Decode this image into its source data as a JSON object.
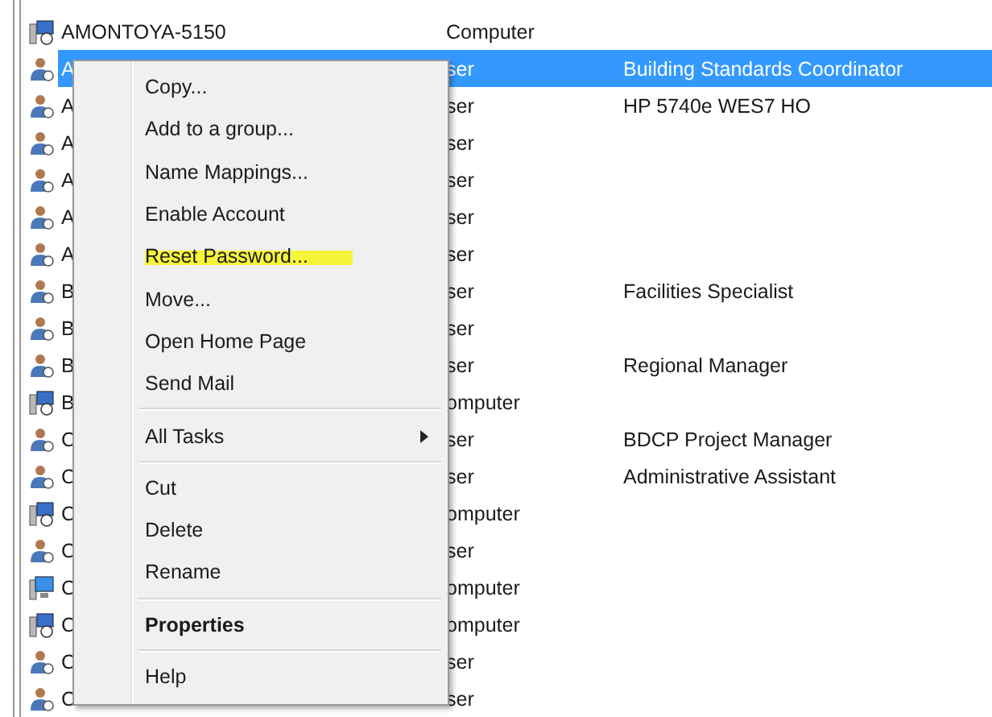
{
  "list": {
    "rows": [
      {
        "kind": "computer",
        "name": "AMONTOYA-5150",
        "type": "Computer",
        "selected": false
      },
      {
        "kind": "user",
        "name": "A",
        "type": "ser",
        "description": "Building Standards Coordinator",
        "selected": true
      },
      {
        "kind": "user",
        "name": "A",
        "type": "ser",
        "description": "HP 5740e WES7 HO",
        "selected": false
      },
      {
        "kind": "user",
        "name": "A",
        "type": "ser",
        "selected": false
      },
      {
        "kind": "user",
        "name": "A",
        "type": "ser",
        "selected": false
      },
      {
        "kind": "user",
        "name": "A",
        "type": "ser",
        "selected": false
      },
      {
        "kind": "user",
        "name": "A",
        "type": "ser",
        "selected": false
      },
      {
        "kind": "user",
        "name": "B",
        "type": "ser",
        "description": "Facilities Specialist",
        "selected": false
      },
      {
        "kind": "user",
        "name": "B",
        "type": "ser",
        "selected": false
      },
      {
        "kind": "user",
        "name": "B",
        "type": "ser",
        "description": "Regional Manager",
        "selected": false
      },
      {
        "kind": "computer",
        "name": "B",
        "type": "omputer",
        "selected": false
      },
      {
        "kind": "user",
        "name": "C",
        "type": "ser",
        "description": "BDCP Project Manager",
        "selected": false
      },
      {
        "kind": "user",
        "name": "C",
        "type": "ser",
        "description": "Administrative Assistant",
        "selected": false
      },
      {
        "kind": "computer",
        "name": "C",
        "type": "omputer",
        "selected": false
      },
      {
        "kind": "user",
        "name": "C",
        "type": "ser",
        "selected": false
      },
      {
        "kind": "monitor",
        "name": "C",
        "type": "omputer",
        "selected": false
      },
      {
        "kind": "computer",
        "name": "C",
        "type": "omputer",
        "selected": false
      },
      {
        "kind": "user",
        "name": "C",
        "type": "ser",
        "selected": false
      },
      {
        "kind": "user",
        "name": "C",
        "type": "ser",
        "selected": false
      }
    ]
  },
  "context_menu": {
    "groups": [
      [
        {
          "label": "Copy...",
          "highlighted": false
        },
        {
          "label": "Add to a group...",
          "highlighted": false
        },
        {
          "label": "Name Mappings...",
          "highlighted": false
        },
        {
          "label": "Enable Account",
          "highlighted": false
        },
        {
          "label": "Reset Password...",
          "highlighted": true
        },
        {
          "label": "Move...",
          "highlighted": false
        },
        {
          "label": "Open Home Page",
          "highlighted": false
        },
        {
          "label": "Send Mail",
          "highlighted": false
        }
      ],
      [
        {
          "label": "All Tasks",
          "highlighted": false,
          "submenu": true
        }
      ],
      [
        {
          "label": "Cut",
          "highlighted": false
        },
        {
          "label": "Delete",
          "highlighted": false
        },
        {
          "label": "Rename",
          "highlighted": false
        }
      ],
      [
        {
          "label": "Properties",
          "highlighted": false,
          "default": true
        }
      ],
      [
        {
          "label": "Help",
          "highlighted": false
        }
      ]
    ]
  }
}
